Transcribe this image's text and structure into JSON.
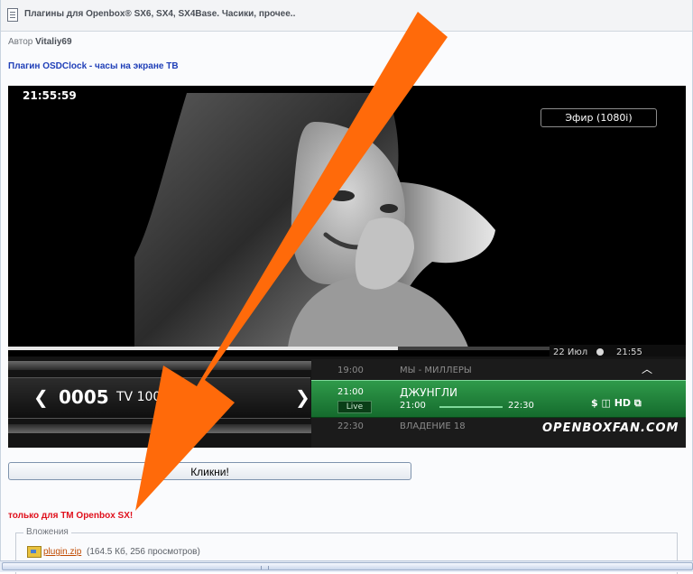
{
  "header": {
    "title": "Плагины для Openbox® SX6, SX4, SX4Base. Часики, прочее.."
  },
  "author": {
    "label": "Автор",
    "name": "Vitaliy69"
  },
  "post": {
    "heading": "Плагин OSDClock - часы на экране ТВ",
    "button_label": "Кликни!",
    "note": "только для ТМ Openbox SX!"
  },
  "tv_screen": {
    "clock": "21:55:59",
    "source": "Эфир (1080i)",
    "date": "22 Июл",
    "time": "21:55",
    "channel_number": "0005",
    "channel_name": "TV 1000 M      HD",
    "epg": [
      {
        "time": "19:00",
        "title": "МЫ - МИЛЛЕРЫ"
      },
      {
        "time": "21:00",
        "title": "ДЖУНГЛИ",
        "live": "Live",
        "from": "21:00",
        "to": "22:30",
        "icons": "$ ◫ HD ⧉"
      },
      {
        "time": "22:30",
        "title": "ВЛАДЕНИЕ 18"
      }
    ],
    "watermark": "OPENBOXFAN.COM"
  },
  "attachments": {
    "legend": "Вложения",
    "file_name": "plugin.zip",
    "file_info": "(164.5 Кб, 256 просмотров)"
  },
  "colors": {
    "heading_blue": "#1f3fb8",
    "note_red": "#e0101c",
    "arrow_orange": "#ff6a0a",
    "epg_green": "#2f9a4a"
  }
}
